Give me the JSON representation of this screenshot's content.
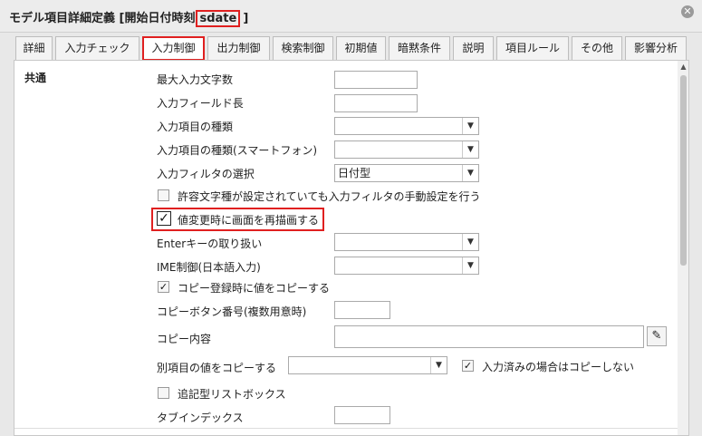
{
  "window": {
    "title_prefix": "モデル項目詳細定義 [開始日付時刻",
    "title_highlight": "sdate",
    "title_suffix": "]"
  },
  "icons": {
    "close": "close-icon",
    "edit": "edit-icon",
    "dropdown": "chevron-down-icon"
  },
  "tabs": [
    "詳細",
    "入力チェック",
    "入力制御",
    "出力制御",
    "検索制御",
    "初期値",
    "暗黙条件",
    "説明",
    "項目ルール",
    "その他",
    "影響分析"
  ],
  "active_tab": "入力制御",
  "section": {
    "label": "共通"
  },
  "fields": {
    "max_chars": {
      "label": "最大入力文字数",
      "value": ""
    },
    "field_length": {
      "label": "入力フィールド長",
      "value": ""
    },
    "input_type": {
      "label": "入力項目の種類",
      "value": ""
    },
    "input_type_sp": {
      "label": "入力項目の種類(スマートフォン)",
      "value": ""
    },
    "input_filter": {
      "label": "入力フィルタの選択",
      "value": "日付型"
    },
    "manual_filter": {
      "label": "許容文字種が設定されていても入力フィルタの手動設定を行う",
      "checked": false
    },
    "redraw": {
      "label": "値変更時に画面を再描画する",
      "checked": true
    },
    "enter_key": {
      "label": "Enterキーの取り扱い",
      "value": ""
    },
    "ime": {
      "label": "IME制御(日本語入力)",
      "value": ""
    },
    "copy_on_register": {
      "label": "コピー登録時に値をコピーする",
      "checked": true
    },
    "copy_button_no": {
      "label": "コピーボタン番号(複数用意時)",
      "value": ""
    },
    "copy_content": {
      "label": "コピー内容",
      "value": ""
    },
    "copy_other": {
      "label": "別項目の値をコピーする",
      "value": ""
    },
    "no_copy_if_entered": {
      "label": "入力済みの場合はコピーしない",
      "checked": true
    },
    "append_listbox": {
      "label": "追記型リストボックス",
      "checked": false
    },
    "tab_index": {
      "label": "タブインデックス",
      "value": ""
    }
  },
  "colors": {
    "highlight": "#e02020"
  }
}
